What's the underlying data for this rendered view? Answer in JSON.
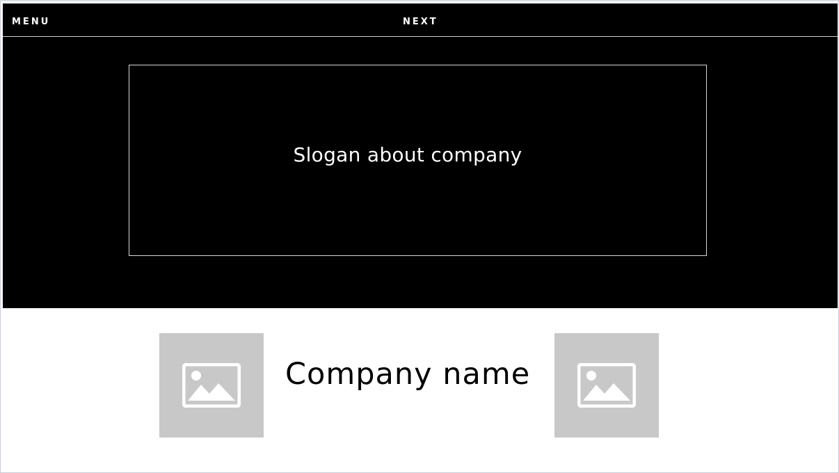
{
  "nav": {
    "menu_label": "MENU",
    "next_label": "NEXT"
  },
  "hero": {
    "slogan": "Slogan about company"
  },
  "brand": {
    "company_name": "Company name",
    "left_image_icon": "image-placeholder-icon",
    "right_image_icon": "image-placeholder-icon"
  },
  "colors": {
    "hero_background": "#000000",
    "text_light": "#ffffff",
    "placeholder_gray": "#c8c8c8"
  }
}
